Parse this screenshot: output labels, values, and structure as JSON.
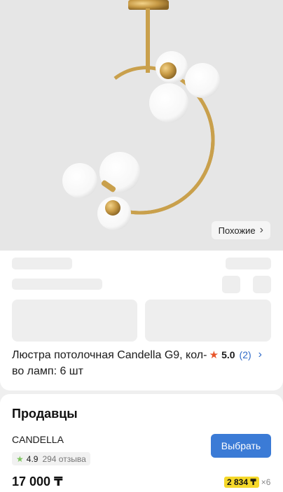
{
  "hero": {
    "similar_label": "Похожие",
    "similar_icon": "chevron-right-icon"
  },
  "product": {
    "title": "Люстра потолочная Candella G9, кол-во ламп: 6 шт",
    "rating": "5.0",
    "rating_count": "(2)",
    "rating_icon": "star-icon",
    "rating_color": "#e8552a"
  },
  "sellers": {
    "title": "Продавцы",
    "items": [
      {
        "name": "CANDELLA",
        "rating": "4.9",
        "reviews": "294 отзыва",
        "select_label": "Выбрать",
        "price": "17 000 ₸",
        "installment": "2 834 ₸",
        "installment_times": "×6"
      }
    ]
  },
  "colors": {
    "accent_button": "#3b7bd6",
    "installment_chip": "#f5d829",
    "seller_star": "#7cc35e"
  }
}
